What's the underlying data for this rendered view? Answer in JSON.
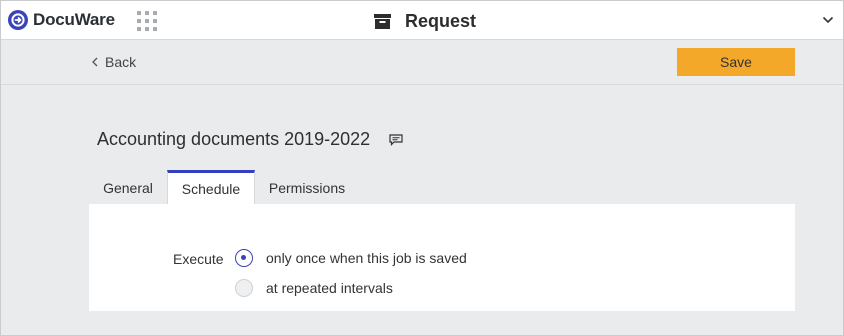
{
  "app": {
    "brand": "DocuWare",
    "brand_color": "#3a44b8"
  },
  "header": {
    "title": "Request",
    "title_icon": "archive-box-icon"
  },
  "toolbar": {
    "back_label": "Back",
    "save_label": "Save",
    "save_color": "#f3a82a"
  },
  "job": {
    "name": "Accounting documents 2019-2022"
  },
  "tabs": [
    {
      "label": "General",
      "active": false
    },
    {
      "label": "Schedule",
      "active": true
    },
    {
      "label": "Permissions",
      "active": false
    }
  ],
  "schedule": {
    "execute_label": "Execute",
    "options": [
      {
        "label": "only once when this job is saved",
        "selected": true
      },
      {
        "label": "at repeated intervals",
        "selected": false
      }
    ]
  }
}
